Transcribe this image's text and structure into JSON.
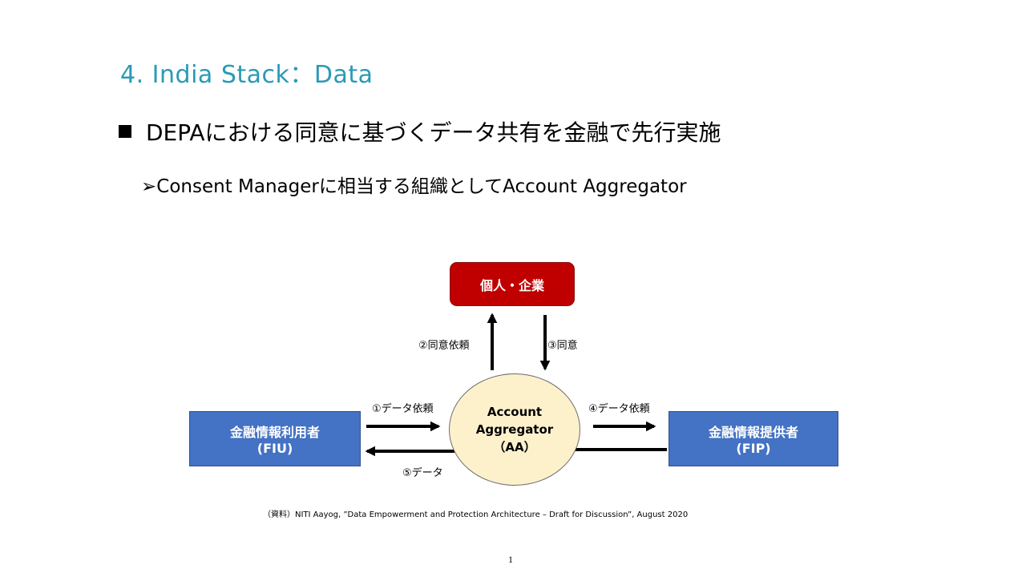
{
  "slide": {
    "heading": "4. India Stack：Data",
    "bullet1": "DEPAにおける同意に基づくデータ共有を金融で先行実施",
    "bullet2": "➢Consent Managerに相当する組織としてAccount Aggregator",
    "source": "（資料）NITI Aayog, ”Data Empowerment and Protection Architecture – Draft for Discussion”, August 2020",
    "page_number": "1"
  },
  "diagram": {
    "person_box": "個人・企業",
    "fiu": {
      "line1": "金融情報利用者",
      "line2": "(FIU)"
    },
    "fip": {
      "line1": "金融情報提供者",
      "line2": "(FIP)"
    },
    "aa": {
      "line1": "Account",
      "line2": "Aggregator",
      "line3": "（AA）"
    },
    "steps": {
      "step1": "①データ依頼",
      "step2": "②同意依頼",
      "step3": "③同意",
      "step4": "④データ依頼",
      "step5": "⑤データ"
    },
    "colors": {
      "person": "#c00000",
      "institution": "#4472c4",
      "aa_fill": "#fdf1cc",
      "heading": "#2a9ab6"
    }
  }
}
